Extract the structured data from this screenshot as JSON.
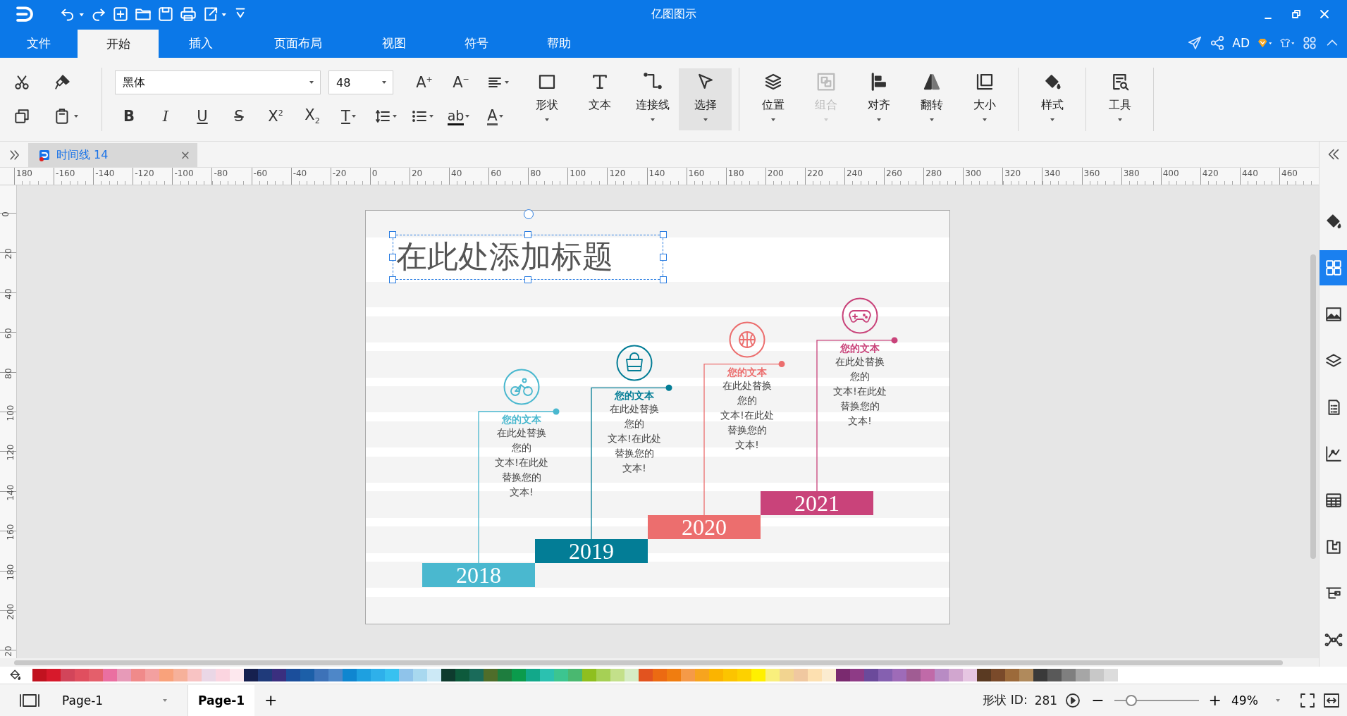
{
  "window": {
    "title": "亿图图示"
  },
  "menu_tabs": [
    {
      "label": "文件",
      "selected": false
    },
    {
      "label": "开始",
      "selected": true
    },
    {
      "label": "插入",
      "selected": false
    },
    {
      "label": "页面布局",
      "selected": false
    },
    {
      "label": "视图",
      "selected": false
    },
    {
      "label": "符号",
      "selected": false
    },
    {
      "label": "帮助",
      "selected": false
    }
  ],
  "account": {
    "label": "AD"
  },
  "font": {
    "family": "黑体",
    "size": "48"
  },
  "format_buttons_top": [
    {
      "kind": "grow",
      "glyph": "A$^{+}$",
      "dropdown": false
    },
    {
      "kind": "shrink",
      "glyph": "A$^{−}$",
      "dropdown": false
    },
    {
      "kind": "align",
      "dropdown": true
    }
  ],
  "format_buttons_bottom": [
    {
      "kind": "bold",
      "glyph": "B",
      "dropdown": false
    },
    {
      "kind": "italic",
      "glyph": "I",
      "dropdown": false
    },
    {
      "kind": "underline",
      "glyph": "U",
      "dropdown": false
    },
    {
      "kind": "strike",
      "glyph": "S",
      "dropdown": false
    },
    {
      "kind": "superscript",
      "glyph": "X$^{2}$",
      "dropdown": false
    },
    {
      "kind": "subscript",
      "glyph": "X$_{2}$",
      "dropdown": false
    },
    {
      "kind": "text-style",
      "glyph": "T",
      "dropdown": true
    },
    {
      "kind": "line-spacing",
      "dropdown": true
    },
    {
      "kind": "bullets",
      "dropdown": true
    },
    {
      "kind": "highlight",
      "glyph": "ab",
      "dropdown": true
    },
    {
      "kind": "font-color",
      "glyph": "A",
      "dropdown": true
    }
  ],
  "large_button_groups": [
    [
      {
        "kind": "shape",
        "label": "形状",
        "dropdown": true,
        "selected": false,
        "disabled": false
      },
      {
        "kind": "text",
        "label": "文本",
        "dropdown": false,
        "selected": false,
        "disabled": false
      },
      {
        "kind": "connector",
        "label": "连接线",
        "dropdown": true,
        "selected": false,
        "disabled": false
      },
      {
        "kind": "select",
        "label": "选择",
        "dropdown": true,
        "selected": true,
        "disabled": false
      }
    ],
    [
      {
        "kind": "position",
        "label": "位置",
        "dropdown": true,
        "selected": false,
        "disabled": false
      },
      {
        "kind": "group",
        "label": "组合",
        "dropdown": true,
        "selected": false,
        "disabled": true
      },
      {
        "kind": "align",
        "label": "对齐",
        "dropdown": true,
        "selected": false,
        "disabled": false
      },
      {
        "kind": "flip",
        "label": "翻转",
        "dropdown": true,
        "selected": false,
        "disabled": false
      },
      {
        "kind": "size",
        "label": "大小",
        "dropdown": true,
        "selected": false,
        "disabled": false
      }
    ],
    [
      {
        "kind": "style",
        "label": "样式",
        "dropdown": true,
        "selected": false,
        "disabled": false
      }
    ],
    [
      {
        "kind": "tools",
        "label": "工具",
        "dropdown": true,
        "selected": false,
        "disabled": false
      }
    ]
  ],
  "document_tabs": [
    {
      "label": "时间线 14",
      "selected": true,
      "close": "×"
    }
  ],
  "ruler": {
    "horizontal": [
      "180",
      "-160",
      "-140",
      "-120",
      "-100",
      "-80",
      "-60",
      "-40",
      "-20",
      "0",
      "20",
      "40",
      "60",
      "80",
      "100",
      "120",
      "140",
      "160",
      "180",
      "200",
      "220",
      "240",
      "260",
      "280",
      "300",
      "320",
      "340",
      "360",
      "380",
      "400",
      "420",
      "440",
      "460"
    ],
    "vertical": [
      "0",
      "20",
      "40",
      "60",
      "80",
      "100",
      "120",
      "140",
      "160",
      "180",
      "200",
      "20"
    ]
  },
  "diagram": {
    "title": {
      "text": "在此处添加标题",
      "selected": true
    },
    "milestones": [
      {
        "year": "2018",
        "heading": "您的文本",
        "body_lines": [
          "在此处替换",
          "您的",
          "文本!在此处",
          "替换您的",
          "文本!"
        ],
        "color": "#4ab8cf"
      },
      {
        "year": "2019",
        "heading": "您的文本",
        "body_lines": [
          "在此处替换",
          "您的",
          "文本!在此处",
          "替换您的",
          "文本!"
        ],
        "color": "#037d96"
      },
      {
        "year": "2020",
        "heading": "您的文本",
        "body_lines": [
          "在此处替换",
          "您的",
          "文本!在此处",
          "替换您的",
          "文本!"
        ],
        "color": "#ec6e6e"
      },
      {
        "year": "2021",
        "heading": "您的文本",
        "body_lines": [
          "在此处替换",
          "您的",
          "文本!在此处",
          "替换您的",
          "文本!"
        ],
        "color": "#c9437a"
      }
    ]
  },
  "side_panel": [
    {
      "selected": false
    },
    {
      "selected": true
    },
    {
      "selected": false
    },
    {
      "selected": false
    },
    {
      "selected": false
    },
    {
      "selected": false
    },
    {
      "selected": false
    },
    {
      "selected": false
    },
    {
      "selected": false
    },
    {
      "selected": false
    }
  ],
  "palette": [
    {
      "color": "#c1121f"
    },
    {
      "color": "#d7192b"
    },
    {
      "color": "#d2455a"
    },
    {
      "color": "#e04f5f"
    },
    {
      "color": "#e45f6b"
    },
    {
      "color": "#ea6fa1"
    },
    {
      "color": "#e79ab8"
    },
    {
      "color": "#f08a8a"
    },
    {
      "color": "#f3a0a0"
    },
    {
      "color": "#f9a27b"
    },
    {
      "color": "#f6b19a"
    },
    {
      "color": "#f8c3c3"
    },
    {
      "color": "#ead7e6"
    },
    {
      "color": "#fbd5e0"
    },
    {
      "color": "#fde8ee"
    },
    {
      "color": "#16204f"
    },
    {
      "color": "#1f3a7a"
    },
    {
      "color": "#3a2f7f"
    },
    {
      "color": "#1b4e9b"
    },
    {
      "color": "#1c5fa8"
    },
    {
      "color": "#3d72b8"
    },
    {
      "color": "#4e87c8"
    },
    {
      "color": "#0f86d0"
    },
    {
      "color": "#1ea0e0"
    },
    {
      "color": "#2eb0ea"
    },
    {
      "color": "#38c1f0"
    },
    {
      "color": "#8fc3ea"
    },
    {
      "color": "#a8d8ef"
    },
    {
      "color": "#cce9f6"
    },
    {
      "color": "#0e3b2e"
    },
    {
      "color": "#0d5a3c"
    },
    {
      "color": "#1a6b5a"
    },
    {
      "color": "#4f6d2a"
    },
    {
      "color": "#1e7d3e"
    },
    {
      "color": "#0b9b4c"
    },
    {
      "color": "#12a88a"
    },
    {
      "color": "#2bc1b0"
    },
    {
      "color": "#3cc590"
    },
    {
      "color": "#4ab870"
    },
    {
      "color": "#8fbf1f"
    },
    {
      "color": "#a6d055"
    },
    {
      "color": "#c3e08a"
    },
    {
      "color": "#d6ecc5"
    },
    {
      "color": "#e2531f"
    },
    {
      "color": "#ec6a12"
    },
    {
      "color": "#f07d10"
    },
    {
      "color": "#f59a48"
    },
    {
      "color": "#f7a41e"
    },
    {
      "color": "#fbb400"
    },
    {
      "color": "#fcc400"
    },
    {
      "color": "#fdd100"
    },
    {
      "color": "#fff000"
    },
    {
      "color": "#f9ef7c"
    },
    {
      "color": "#f2d490"
    },
    {
      "color": "#f0c8a0"
    },
    {
      "color": "#fde0b0"
    },
    {
      "color": "#fbecd0"
    },
    {
      "color": "#7a2a6f"
    },
    {
      "color": "#8e3b86"
    },
    {
      "color": "#6b4a9b"
    },
    {
      "color": "#8560b0"
    },
    {
      "color": "#9e6bb8"
    },
    {
      "color": "#a05c93"
    },
    {
      "color": "#c06aa8"
    },
    {
      "color": "#b88bc4"
    },
    {
      "color": "#d1a6cf"
    },
    {
      "color": "#e6c6e2"
    },
    {
      "color": "#5a3a22"
    },
    {
      "color": "#7a4a2a"
    },
    {
      "color": "#9c6a3a"
    },
    {
      "color": "#b08a5c"
    },
    {
      "color": "#3a3a3a"
    },
    {
      "color": "#595959"
    },
    {
      "color": "#7f7f7f"
    },
    {
      "color": "#a6a6a6"
    },
    {
      "color": "#c8c8c8"
    },
    {
      "color": "#dcdcdc"
    }
  ],
  "status_bar": {
    "page_selector": "Page-1",
    "page_tabs": [
      {
        "label": "Page-1",
        "selected": true
      }
    ],
    "add_page": "+",
    "shape_id_label": "形状 ID:",
    "shape_id": "281",
    "zoom_out": "−",
    "zoom_in": "+",
    "zoom_slider": {
      "level": 0.2
    },
    "zoom": "49%"
  }
}
